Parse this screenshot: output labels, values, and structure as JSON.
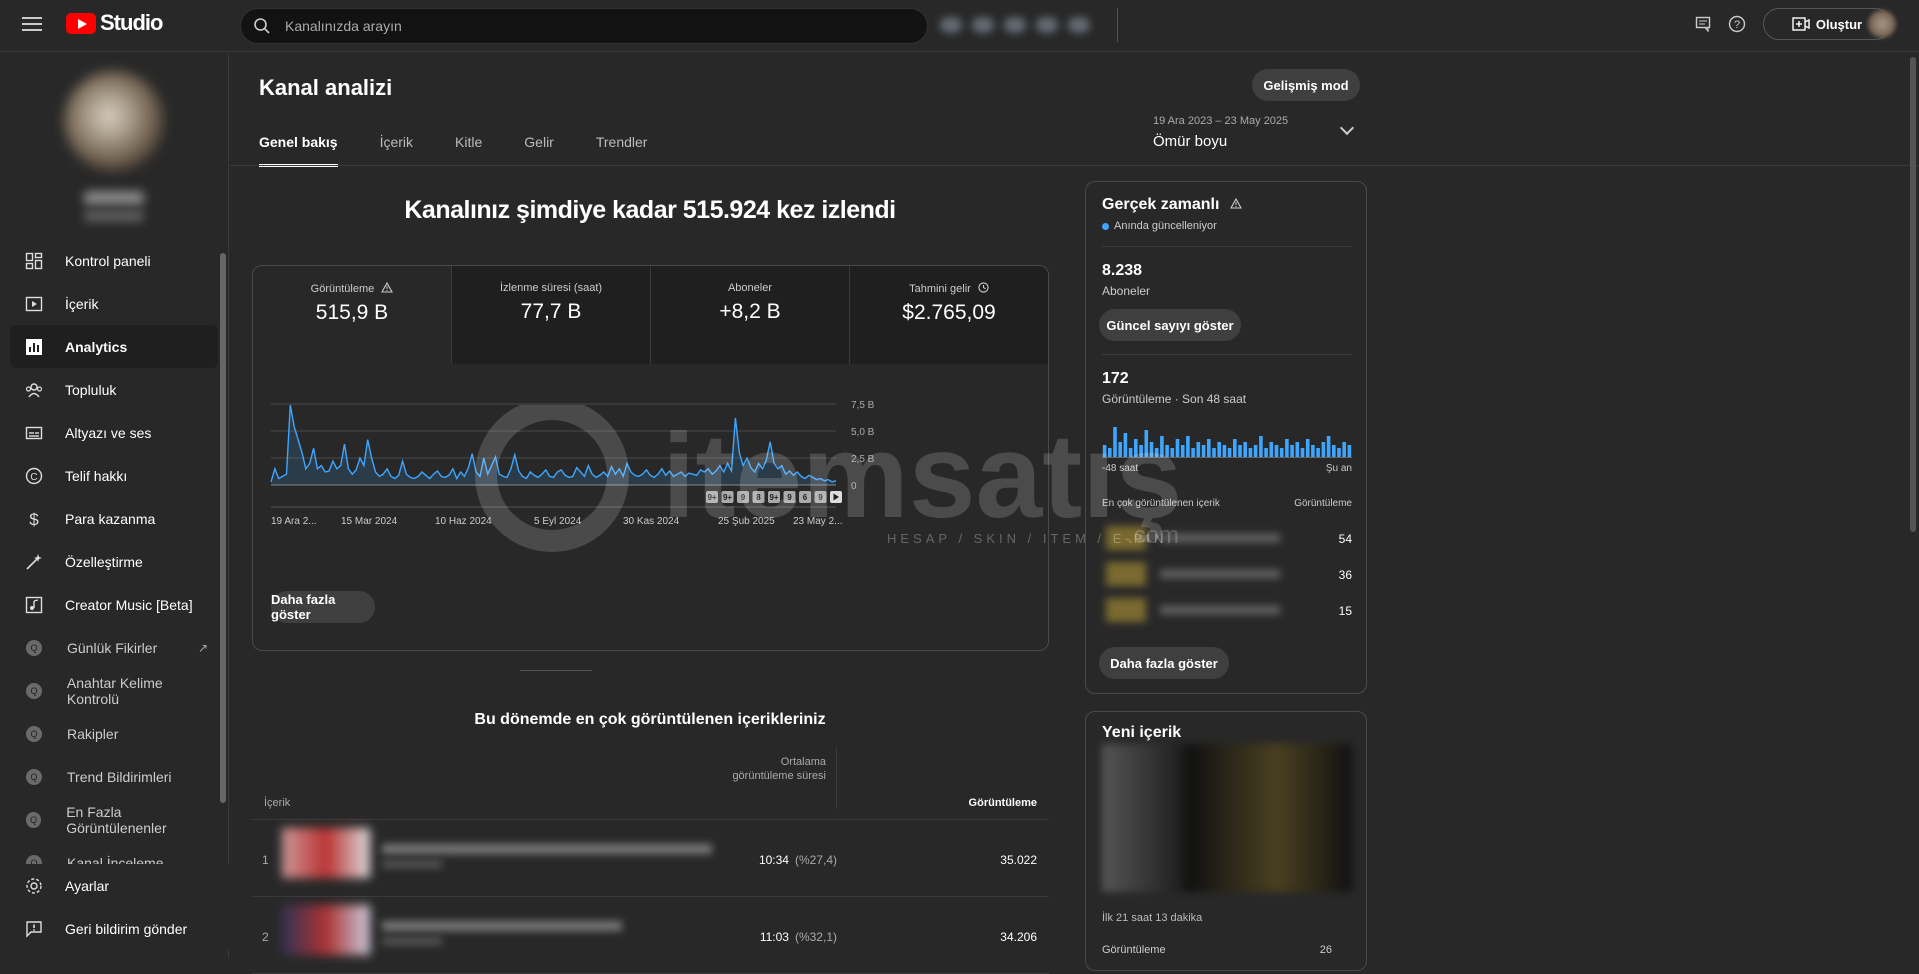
{
  "app": {
    "logo_text": "Studio"
  },
  "search": {
    "placeholder": "Kanalınızda arayın"
  },
  "topbar": {
    "create_label": "Oluştur",
    "icons": [
      "comments-icon",
      "help-icon",
      "create-icon"
    ]
  },
  "sidebar": {
    "items": [
      {
        "label": "Kontrol paneli",
        "icon": "dashboard-icon"
      },
      {
        "label": "İçerik",
        "icon": "content-icon"
      },
      {
        "label": "Analytics",
        "icon": "analytics-icon",
        "active": true
      },
      {
        "label": "Topluluk",
        "icon": "community-icon"
      },
      {
        "label": "Altyazı ve ses",
        "icon": "subtitles-icon"
      },
      {
        "label": "Telif hakkı",
        "icon": "copyright-icon"
      },
      {
        "label": "Para kazanma",
        "icon": "dollar-icon"
      },
      {
        "label": "Özelleştirme",
        "icon": "magic-wand-icon"
      },
      {
        "label": "Creator Music [Beta]",
        "icon": "music-icon"
      },
      {
        "label": "Günlük Fikirler",
        "icon": "extension-icon",
        "external": true
      },
      {
        "label": "Anahtar Kelime Kontrolü",
        "icon": "extension-icon"
      },
      {
        "label": "Rakipler",
        "icon": "extension-icon"
      },
      {
        "label": "Trend Bildirimleri",
        "icon": "extension-icon"
      },
      {
        "label": "En Fazla Görüntülenenler",
        "icon": "extension-icon"
      },
      {
        "label": "Kanal İnceleme",
        "icon": "extension-icon"
      }
    ],
    "bottom": [
      {
        "label": "Ayarlar",
        "icon": "gear-icon"
      },
      {
        "label": "Geri bildirim gönder",
        "icon": "feedback-icon"
      }
    ]
  },
  "page": {
    "title": "Kanal analizi",
    "advanced_mode": "Gelişmiş mod",
    "tabs": [
      "Genel bakış",
      "İçerik",
      "Kitle",
      "Gelir",
      "Trendler"
    ],
    "date_range": {
      "range": "19 Ara 2023 – 23 May 2025",
      "label": "Ömür boyu"
    }
  },
  "overview": {
    "headline": "Kanalınız şimdiye kadar 515.924 kez izlendi",
    "metrics": [
      {
        "label": "Görüntüleme",
        "value": "515,9 B",
        "icon": "warning-icon"
      },
      {
        "label": "İzlenme süresi (saat)",
        "value": "77,7 B"
      },
      {
        "label": "Aboneler",
        "value": "+8,2 B"
      },
      {
        "label": "Tahmini gelir",
        "value": "$2.765,09",
        "icon": "clock-icon"
      }
    ],
    "more_button": "Daha fazla göster"
  },
  "chart_data": {
    "type": "line",
    "series": [
      {
        "values": [
          0.3,
          1.5,
          0.6,
          0.8,
          1.0,
          7.4,
          5.4,
          4.2,
          3.0,
          1.5,
          2.0,
          3.4,
          1.5,
          1.8,
          1.2,
          1.3,
          2.2,
          1.5,
          1.8,
          3.8,
          1.5,
          1.0,
          1.4,
          2.5,
          1.8,
          4.2,
          2.5,
          1.2,
          0.8,
          1.0,
          1.5,
          0.8,
          0.6,
          0.9,
          2.2,
          1.0,
          0.7,
          0.6,
          0.8,
          1.2,
          0.9,
          0.6,
          1.0,
          1.3,
          0.8,
          0.7,
          0.9,
          1.5,
          0.6,
          1.2,
          0.8,
          1.6,
          2.9,
          1.2,
          0.8,
          2.5,
          1.0,
          1.8,
          2.6,
          1.0,
          0.8,
          0.7,
          1.5,
          2.8,
          1.3,
          0.8,
          0.6,
          1.2,
          0.9,
          0.7,
          1.0,
          1.4,
          0.8,
          0.7,
          1.2,
          1.4,
          0.9,
          0.7,
          0.8,
          1.6,
          1.2,
          0.8,
          1.8,
          1.0,
          0.7,
          0.9,
          1.2,
          0.8,
          1.7,
          1.0,
          1.5,
          0.8,
          2.0,
          1.2,
          0.9,
          0.8,
          1.0,
          1.4,
          0.9,
          0.7,
          1.0,
          1.5,
          0.9,
          1.3,
          0.8,
          1.0,
          1.2,
          0.8,
          1.1,
          1.0,
          0.9,
          1.4,
          1.2,
          1.5,
          1.0,
          1.3,
          1.8,
          1.2,
          2.0,
          1.3,
          6.2,
          3.0,
          1.8,
          2.5,
          1.6,
          1.2,
          2.0,
          1.5,
          2.3,
          4.0,
          2.0,
          1.5,
          1.8,
          1.0,
          1.3,
          0.9,
          1.2,
          0.8,
          0.6,
          0.9,
          0.7,
          0.5,
          0.6,
          0.4,
          0.5,
          0.3,
          0.4
        ]
      }
    ],
    "x_ticks": [
      "19 Ara 2...",
      "15 Mar 2024",
      "10 Haz 2024",
      "5 Eyl 2024",
      "30 Kas 2024",
      "25 Şub 2025",
      "23 May 2..."
    ],
    "y_ticks": [
      "7,5 B",
      "5,0 B",
      "2,5 B",
      "0"
    ],
    "ylim": [
      0,
      7.5
    ],
    "video_markers": [
      "9+",
      "9+",
      "9",
      "8",
      "9+",
      "9",
      "6",
      "9"
    ]
  },
  "realtime": {
    "title": "Gerçek zamanlı",
    "live": "Anında güncelleniyor",
    "subscribers": "8.238",
    "subscribers_label": "Aboneler",
    "show_count": "Güncel sayıyı göster",
    "views": "172",
    "views_label": "Görüntüleme · Son 48 saat",
    "bars": [
      0.4,
      0.3,
      1.0,
      0.5,
      0.8,
      0.3,
      0.6,
      0.4,
      0.9,
      0.5,
      0.3,
      0.7,
      0.4,
      0.3,
      0.6,
      0.4,
      0.7,
      0.3,
      0.5,
      0.4,
      0.6,
      0.3,
      0.5,
      0.4,
      0.3,
      0.6,
      0.4,
      0.5,
      0.3,
      0.4,
      0.7,
      0.3,
      0.5,
      0.4,
      0.3,
      0.6,
      0.4,
      0.5,
      0.3,
      0.6,
      0.4,
      0.3,
      0.5,
      0.7,
      0.4,
      0.3,
      0.5,
      0.4
    ],
    "axis_start": "-48 saat",
    "axis_end": "Şu an",
    "top_head_left": "En çok görüntülenen içerik",
    "top_head_right": "Görüntüleme",
    "top_rows": [
      "54",
      "36",
      "15"
    ],
    "more_button": "Daha fazla göster"
  },
  "top_content": {
    "title": "Bu dönemde en çok görüntülenen içerikleriniz",
    "headers": {
      "content": "İçerik",
      "avg": "Ortalama görüntüleme süresi",
      "views": "Görüntüleme"
    },
    "rows": [
      {
        "num": "1",
        "duration": "10:34",
        "pct": "(%27,4)",
        "views": "35.022"
      },
      {
        "num": "2",
        "duration": "11:03",
        "pct": "(%32,1)",
        "views": "34.206"
      }
    ]
  },
  "new_content": {
    "title": "Yeni içerik",
    "time": "İlk 21 saat 13 dakika",
    "footer_left": "Görüntüleme",
    "footer_right": "26"
  },
  "watermark": {
    "text": "itemsatış",
    "sub": "HESAP / SKIN / ITEM / E-PIN",
    "suffix": ".com"
  }
}
